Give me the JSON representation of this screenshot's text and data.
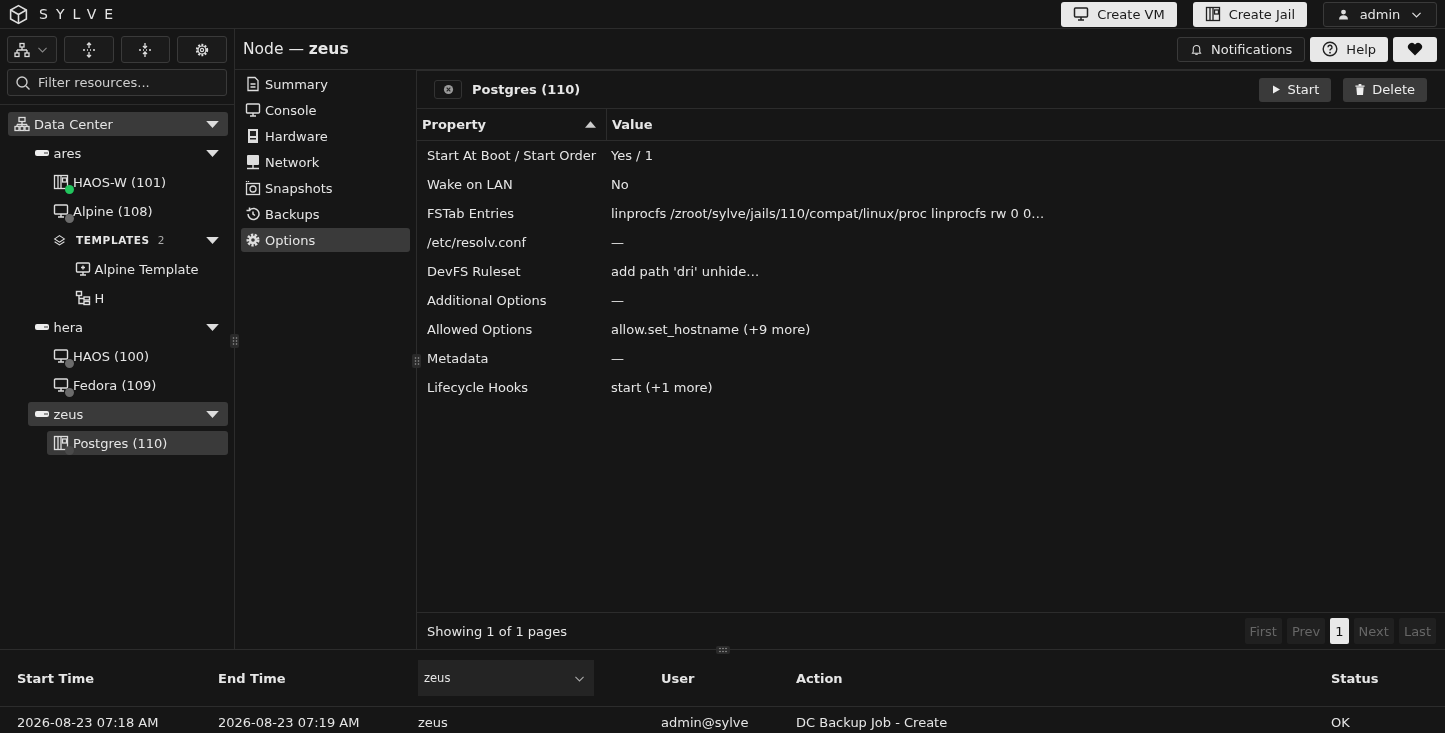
{
  "app": {
    "brand": "SYLVE"
  },
  "top_actions": [
    {
      "label": "Create VM",
      "kind": "vm"
    },
    {
      "label": "Create Jail",
      "kind": "jail"
    }
  ],
  "user_menu": {
    "label": "admin"
  },
  "sidebar": {
    "filter": {
      "placeholder": "Filter resources..."
    },
    "tree": [
      {
        "label": "Data Center",
        "kind": "datacenter",
        "expanded": true,
        "selected": true,
        "children": [
          {
            "label": "ares",
            "kind": "node",
            "expanded": true,
            "selected": false,
            "children": [
              {
                "label": "HAOS-W (101)",
                "kind": "jail",
                "selected": false,
                "color": "#22c55e"
              },
              {
                "label": "Alpine (108)",
                "kind": "vm",
                "selected": false,
                "color": "#6b6b6b"
              },
              {
                "label": "TEMPLATES",
                "count": "2",
                "kind": "group",
                "expanded": true,
                "selected": false,
                "children": [
                  {
                    "label": "Alpine Template",
                    "kind": "template",
                    "selected": false
                  },
                  {
                    "label": "H",
                    "kind": "jail-template",
                    "selected": false
                  }
                ]
              }
            ]
          },
          {
            "label": "hera",
            "kind": "node",
            "expanded": true,
            "selected": false,
            "children": [
              {
                "label": "HAOS (100)",
                "kind": "vm",
                "selected": false,
                "color": "#6b6b6b"
              },
              {
                "label": "Fedora (109)",
                "kind": "vm",
                "selected": false,
                "color": "#6b6b6b"
              }
            ]
          },
          {
            "label": "zeus",
            "kind": "node",
            "expanded": true,
            "selected": true,
            "children": [
              {
                "label": "Postgres (110)",
                "kind": "jail",
                "selected": true,
                "color": "#4a4a4a"
              }
            ]
          }
        ]
      }
    ]
  },
  "header": {
    "prefix": "Node —",
    "node": "zeus",
    "buttons": [
      {
        "label": "Notifications",
        "kind": "bell"
      },
      {
        "label": "Help",
        "kind": "help"
      },
      {
        "kind": "heart"
      }
    ]
  },
  "nav": [
    {
      "label": "Summary",
      "kind": "summary",
      "selected": false
    },
    {
      "label": "Console",
      "kind": "console",
      "selected": false
    },
    {
      "label": "Hardware",
      "kind": "hardware",
      "selected": false
    },
    {
      "label": "Network",
      "kind": "network",
      "selected": false
    },
    {
      "label": "Snapshots",
      "kind": "snapshots",
      "selected": false
    },
    {
      "label": "Backups",
      "kind": "backups",
      "selected": false
    },
    {
      "label": "Options",
      "kind": "options",
      "selected": true
    }
  ],
  "panel": {
    "title": "Postgres (110)",
    "actions": [
      {
        "label": "Start",
        "kind": "play"
      },
      {
        "label": "Delete",
        "kind": "trash"
      }
    ],
    "table": {
      "columns": [
        {
          "label": "Property",
          "sorted": true
        },
        {
          "label": "Value",
          "sorted": false
        }
      ],
      "rows": [
        [
          "Start At Boot / Start Order",
          "Yes / 1"
        ],
        [
          "Wake on LAN",
          "No"
        ],
        [
          "FSTab Entries",
          "linprocfs /zroot/sylve/jails/110/compat/linux/proc linprocfs rw 0 0…"
        ],
        [
          "/etc/resolv.conf",
          "—"
        ],
        [
          "DevFS Ruleset",
          "add path 'dri' unhide…"
        ],
        [
          "Additional Options",
          "—"
        ],
        [
          "Allowed Options",
          "allow.set_hostname (+9 more)"
        ],
        [
          "Metadata",
          "—"
        ],
        [
          "Lifecycle Hooks",
          "start (+1 more)"
        ]
      ]
    },
    "footer": {
      "summary": "Showing 1 of 1 pages",
      "pages": [
        {
          "label": "First",
          "disabled": true,
          "selected": false
        },
        {
          "label": "Prev",
          "disabled": true,
          "selected": false
        },
        {
          "label": "1",
          "disabled": false,
          "selected": true
        },
        {
          "label": "Next",
          "disabled": true,
          "selected": false
        },
        {
          "label": "Last",
          "disabled": true,
          "selected": false
        }
      ]
    }
  },
  "audit": {
    "columns": [
      {
        "label": "Start Time",
        "kind": "text"
      },
      {
        "label": "End Time",
        "kind": "text"
      },
      {
        "value": "zeus",
        "kind": "select"
      },
      {
        "label": "User",
        "kind": "text"
      },
      {
        "label": "Action",
        "kind": "text"
      },
      {
        "label": "Status",
        "kind": "text"
      }
    ],
    "rows": [
      [
        "2026-08-23 07:18 AM",
        "2026-08-23 07:19 AM",
        "zeus",
        "admin@sylve",
        "DC Backup Job - Create",
        "OK"
      ]
    ]
  }
}
